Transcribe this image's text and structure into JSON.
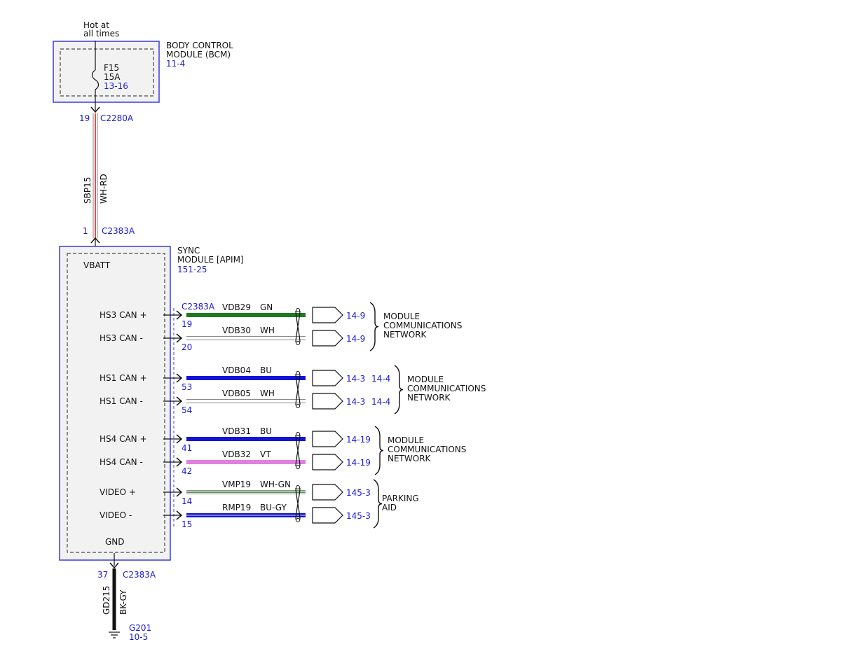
{
  "colors": {
    "module_border": "#3a3ae0",
    "module_fill": "#f2f2f2",
    "ref_text": "#1a1ad6",
    "wire_green": "#1e7a1e",
    "wire_blue": "#1414d8",
    "wire_violet": "#e080e0",
    "wire_red": "#e02020",
    "wire_black": "#111111",
    "wire_white_outline": "#888888"
  },
  "power": {
    "label_line1": "Hot at",
    "label_line2": "all times"
  },
  "bcm": {
    "title_line1": "BODY CONTROL",
    "title_line2": "MODULE (BCM)",
    "ref": "11-4",
    "fuse_name": "F15",
    "fuse_rating": "15A",
    "fuse_ref": "13-16",
    "pin": "19",
    "connector": "C2280A"
  },
  "feed_wire": {
    "circuit": "SBP15",
    "color": "WH-RD"
  },
  "sync": {
    "title_line1": "SYNC",
    "title_line2": "MODULE [APIM]",
    "ref": "151-25",
    "vbatt_pin": "1",
    "vbatt_connector": "C2383A",
    "vbatt_label": "VBATT",
    "gnd_label": "GND",
    "signal_connector": "C2383A"
  },
  "signals": [
    {
      "label": "HS3 CAN +",
      "pin": "19",
      "circuit": "VDB29",
      "color": "GN",
      "refs": [
        "14-9"
      ],
      "wire": "green"
    },
    {
      "label": "HS3 CAN -",
      "pin": "20",
      "circuit": "VDB30",
      "color": "WH",
      "refs": [
        "14-9"
      ],
      "wire": "white"
    },
    {
      "label": "HS1 CAN +",
      "pin": "53",
      "circuit": "VDB04",
      "color": "BU",
      "refs": [
        "14-3",
        "14-4"
      ],
      "wire": "blue"
    },
    {
      "label": "HS1 CAN -",
      "pin": "54",
      "circuit": "VDB05",
      "color": "WH",
      "refs": [
        "14-3",
        "14-4"
      ],
      "wire": "white"
    },
    {
      "label": "HS4 CAN +",
      "pin": "41",
      "circuit": "VDB31",
      "color": "BU",
      "refs": [
        "14-19"
      ],
      "wire": "blue"
    },
    {
      "label": "HS4 CAN -",
      "pin": "42",
      "circuit": "VDB32",
      "color": "VT",
      "refs": [
        "14-19"
      ],
      "wire": "violet"
    },
    {
      "label": "VIDEO +",
      "pin": "14",
      "circuit": "VMP19",
      "color": "WH-GN",
      "refs": [
        "145-3"
      ],
      "wire": "whitegreen"
    },
    {
      "label": "VIDEO -",
      "pin": "15",
      "circuit": "RMP19",
      "color": "BU-GY",
      "refs": [
        "145-3"
      ],
      "wire": "bluegray"
    }
  ],
  "groups": [
    {
      "line1": "MODULE",
      "line2": "COMMUNICATIONS",
      "line3": "NETWORK"
    },
    {
      "line1": "MODULE",
      "line2": "COMMUNICATIONS",
      "line3": "NETWORK"
    },
    {
      "line1": "MODULE",
      "line2": "COMMUNICATIONS",
      "line3": "NETWORK"
    },
    {
      "line1": "PARKING",
      "line2": "AID",
      "line3": ""
    }
  ],
  "ground": {
    "pin": "37",
    "connector": "C2383A",
    "circuit": "GD215",
    "color": "BK-GY",
    "location": "G201",
    "ref": "10-5"
  }
}
